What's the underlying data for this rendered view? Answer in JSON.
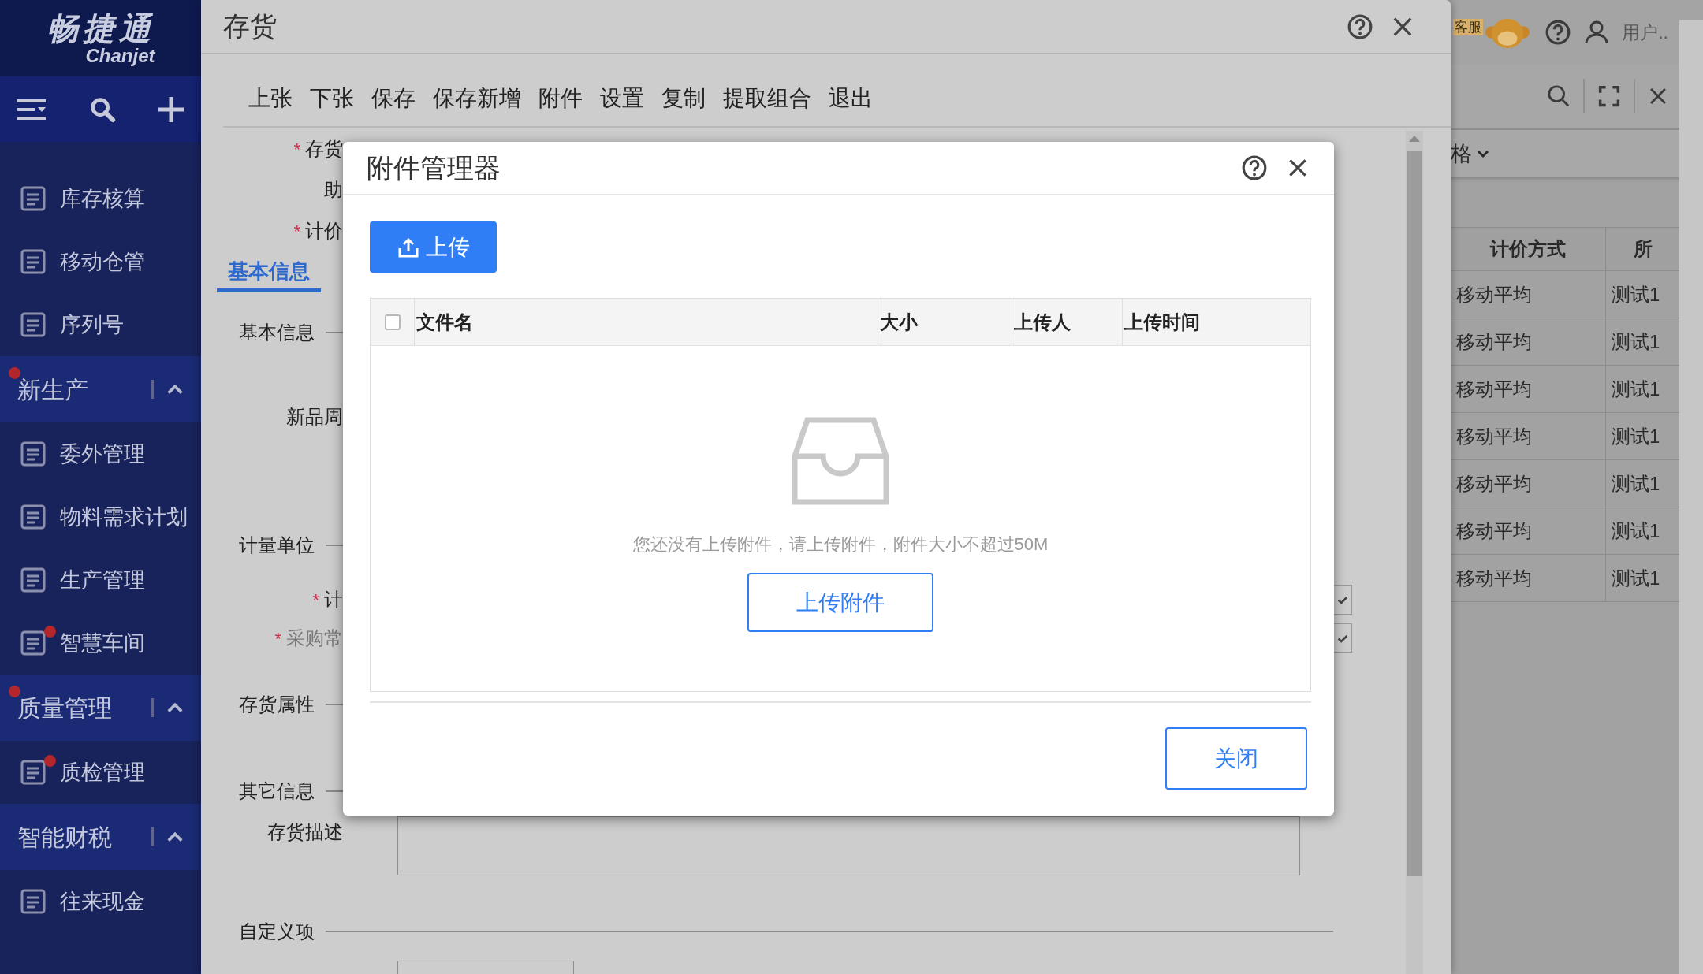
{
  "sidebar": {
    "logo": "畅捷通",
    "logo_sub": "Chanjet",
    "items": [
      {
        "kind": "item",
        "label": "库存核算",
        "badge": false
      },
      {
        "kind": "item",
        "label": "移动仓管",
        "badge": false
      },
      {
        "kind": "item",
        "label": "序列号",
        "badge": false
      },
      {
        "kind": "group",
        "label": "新生产",
        "badge": true,
        "expanded": true
      },
      {
        "kind": "item",
        "label": "委外管理",
        "badge": false
      },
      {
        "kind": "item",
        "label": "物料需求计划",
        "badge": false
      },
      {
        "kind": "item",
        "label": "生产管理",
        "badge": false
      },
      {
        "kind": "item",
        "label": "智慧车间",
        "badge": true
      },
      {
        "kind": "group",
        "label": "质量管理",
        "badge": true,
        "expanded": true
      },
      {
        "kind": "item",
        "label": "质检管理",
        "badge": true
      },
      {
        "kind": "group",
        "label": "智能财税",
        "badge": false,
        "expanded": true
      },
      {
        "kind": "item",
        "label": "往来现金",
        "badge": false
      }
    ]
  },
  "header": {
    "support_tag": "客服",
    "user": "用户..",
    "filter": "格"
  },
  "table": {
    "columns": [
      "计价方式",
      "所"
    ],
    "rows": [
      [
        "移动平均",
        "测试1"
      ],
      [
        "移动平均",
        "测试1"
      ],
      [
        "移动平均",
        "测试1"
      ],
      [
        "移动平均",
        "测试1"
      ],
      [
        "移动平均",
        "测试1"
      ],
      [
        "移动平均",
        "测试1"
      ],
      [
        "移动平均",
        "测试1"
      ]
    ]
  },
  "dialog": {
    "title": "存货",
    "toolbar": [
      "上张",
      "下张",
      "保存",
      "保存新增",
      "附件",
      "设置",
      "复制",
      "提取组合",
      "退出"
    ],
    "form": [
      {
        "kind": "field",
        "label": "存货",
        "marker": "*"
      },
      {
        "kind": "field",
        "label": "助"
      },
      {
        "kind": "field",
        "label": "计价",
        "marker": "*"
      },
      {
        "kind": "tab",
        "label": "基本信息",
        "selected": true
      },
      {
        "kind": "section",
        "label": "基本信息"
      },
      {
        "kind": "field",
        "label": "新品周"
      },
      {
        "kind": "section",
        "label": "计量单位"
      },
      {
        "kind": "select",
        "label": "计",
        "marker": "*"
      },
      {
        "kind": "select",
        "label": "采购常",
        "marker": "*"
      },
      {
        "kind": "section",
        "label": "存货属性"
      },
      {
        "kind": "section",
        "label": "其它信息"
      },
      {
        "kind": "textarea",
        "label": "存货描述"
      },
      {
        "kind": "section",
        "label": "自定义项"
      },
      {
        "kind": "input"
      }
    ]
  },
  "modal": {
    "title": "附件管理器",
    "upload": "上传",
    "columns": [
      "文件名",
      "大小",
      "上传人",
      "上传时间"
    ],
    "select_all": false,
    "empty_text": "您还没有上传附件，请上传附件，附件大小不超过50M",
    "upload_attachment": "上传附件",
    "close": "关闭"
  }
}
